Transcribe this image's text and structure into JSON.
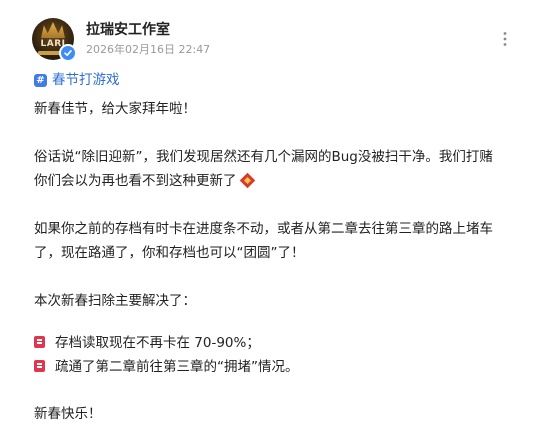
{
  "author": {
    "name": "拉瑞安工作室",
    "avatar_text": "LARI",
    "timestamp": "2026年02月16日 22:47"
  },
  "topic": {
    "label": "春节打游戏"
  },
  "post": {
    "greeting": "新春佳节，给大家拜年啦！",
    "para1_line1": "俗话说“除旧迎新”，我们发现居然还有几个漏网的Bug没被扫干净。我们打赌",
    "para1_line2": "你们会以为再也看不到这种更新了",
    "para2_line1": "如果你之前的存档有时卡在进度条不动，或者从第二章去往第三章的路上堵车",
    "para2_line2": "了，现在路通了，你和存档也可以“团圆”了！",
    "fixes_intro": "本次新春扫除主要解决了：",
    "fixes": [
      "存档读取现在不再卡在 70-90%；",
      "疏通了第二章前往第三章的“拥堵”情况。"
    ],
    "closing": "新春快乐！"
  },
  "icons": {
    "verified": "verified-badge-icon",
    "more": "more-vertical-icon",
    "topic": "topic-hash-icon",
    "emoji": "red-envelope-emoji",
    "bullet": "red-bullet-emoji"
  },
  "colors": {
    "topic_link": "#2f6fd6",
    "timestamp": "#9a9a9a",
    "verified": "#3d8df5",
    "bullet": "#e0354d"
  }
}
